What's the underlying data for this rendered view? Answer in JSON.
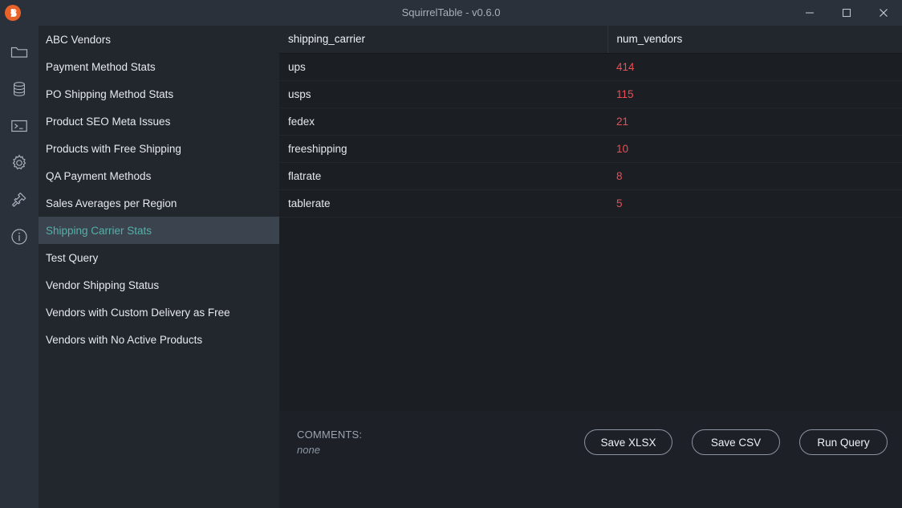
{
  "window": {
    "title": "SquirrelTable - v0.6.0",
    "logo_icon": "squirrel-logo-icon",
    "logo_color": "#e8622a",
    "controls": {
      "minimize": "minimize-icon",
      "maximize": "maximize-icon",
      "close": "close-icon"
    }
  },
  "rail": {
    "items": [
      {
        "icon": "folder-icon"
      },
      {
        "icon": "database-icon"
      },
      {
        "icon": "terminal-icon"
      },
      {
        "icon": "gear-icon"
      },
      {
        "icon": "hammer-icon"
      },
      {
        "icon": "info-icon"
      }
    ]
  },
  "sidebar": {
    "items": [
      {
        "label": "ABC Vendors",
        "selected": false
      },
      {
        "label": "Payment Method Stats",
        "selected": false
      },
      {
        "label": "PO Shipping Method Stats",
        "selected": false
      },
      {
        "label": "Product SEO Meta Issues",
        "selected": false
      },
      {
        "label": "Products with Free Shipping",
        "selected": false
      },
      {
        "label": "QA Payment Methods",
        "selected": false
      },
      {
        "label": "Sales Averages per Region",
        "selected": false
      },
      {
        "label": "Shipping Carrier Stats",
        "selected": true
      },
      {
        "label": "Test Query",
        "selected": false
      },
      {
        "label": "Vendor Shipping Status",
        "selected": false
      },
      {
        "label": "Vendors with Custom Delivery as Free",
        "selected": false
      },
      {
        "label": "Vendors with No Active Products",
        "selected": false
      }
    ],
    "selected_color": "#56b0a8",
    "selected_bg": "#3b434f"
  },
  "results": {
    "columns": [
      "shipping_carrier",
      "num_vendors"
    ],
    "rows": [
      {
        "shipping_carrier": "ups",
        "num_vendors": "414"
      },
      {
        "shipping_carrier": "usps",
        "num_vendors": "115"
      },
      {
        "shipping_carrier": "fedex",
        "num_vendors": "21"
      },
      {
        "shipping_carrier": "freeshipping",
        "num_vendors": "10"
      },
      {
        "shipping_carrier": "flatrate",
        "num_vendors": "8"
      },
      {
        "shipping_carrier": "tablerate",
        "num_vendors": "5"
      }
    ],
    "number_color": "#e94f55"
  },
  "footer": {
    "comments_label": "COMMENTS:",
    "comments_value": "none",
    "buttons": [
      {
        "label": "Save XLSX"
      },
      {
        "label": "Save CSV"
      },
      {
        "label": "Run Query"
      }
    ]
  }
}
